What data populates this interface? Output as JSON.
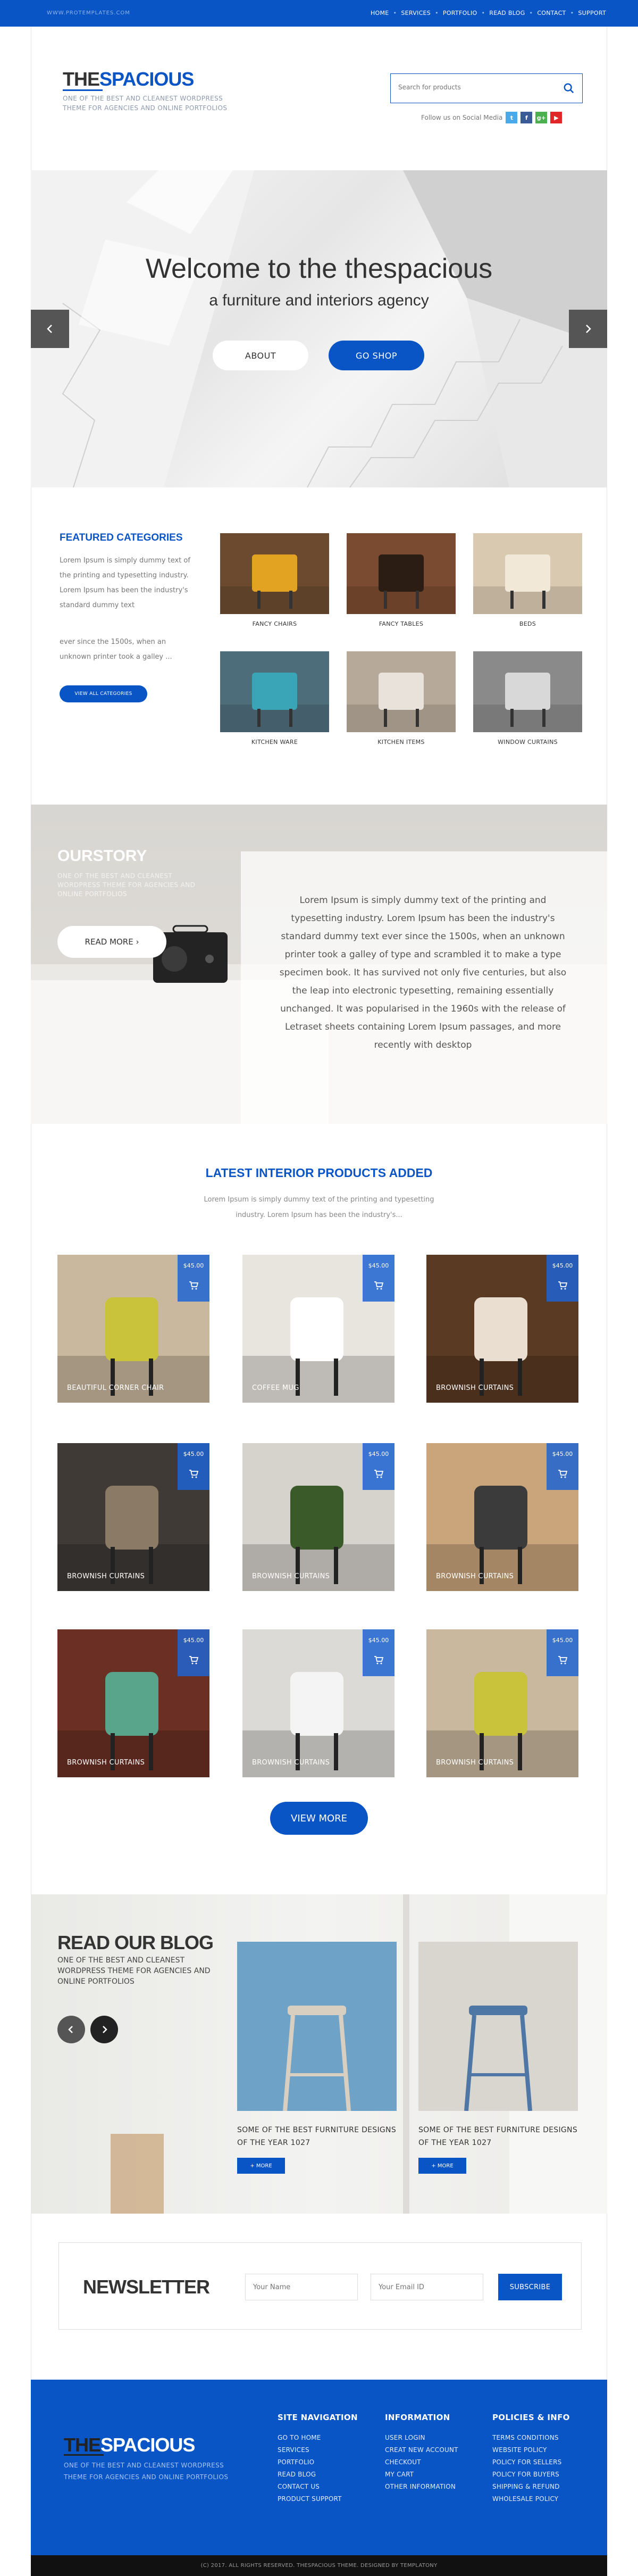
{
  "topbar": {
    "site": "WWW.PROTEMPLATES.COM",
    "nav": [
      "HOME",
      "SERVICES",
      "PORTFOLIO",
      "READ BLOG",
      "CONTACT",
      "SUPPORT"
    ]
  },
  "header": {
    "logo_a": "THE",
    "logo_b": "SPACIOUS",
    "tagline": "ONE OF THE BEST AND CLEANEST WORDPRESS THEME FOR AGENCIES AND ONLINE PORTFOLIOS",
    "search_placeholder": "Search for products",
    "social_label": "Follow us on Social Media",
    "social": [
      {
        "icon": "twitter-icon",
        "glyph": "t",
        "color": "#4aa9e8"
      },
      {
        "icon": "facebook-icon",
        "glyph": "f",
        "color": "#3b5b98"
      },
      {
        "icon": "google-plus-icon",
        "glyph": "g+",
        "color": "#4caf50"
      },
      {
        "icon": "youtube-icon",
        "glyph": "▶",
        "color": "#e02626"
      }
    ]
  },
  "hero": {
    "title": "Welcome to the thespacious",
    "subtitle": "a furniture and interiors agency",
    "about": "ABOUT",
    "shop": "GO SHOP"
  },
  "featured": {
    "title": "FEATURED CATEGORIES",
    "text": "Lorem Ipsum is simply dummy text of the printing and typesetting industry. Lorem Ipsum has been the industry's standard dummy text",
    "text2": "ever since the 1500s, when an unknown printer took a galley ...",
    "button": "VIEW ALL CATEGORIES",
    "categories": [
      {
        "label": "FANCY CHAIRS",
        "bg": "#6b4a2f",
        "accent": "#e3a322"
      },
      {
        "label": "FANCY TABLES",
        "bg": "#7a4b30",
        "accent": "#2c1d14"
      },
      {
        "label": "BEDS",
        "bg": "#d9c9b0",
        "accent": "#f1e8d8"
      },
      {
        "label": "KITCHEN WARE",
        "bg": "#4e6d7a",
        "accent": "#3aa5b6"
      },
      {
        "label": "KITCHEN ITEMS",
        "bg": "#b7a99a",
        "accent": "#e8e2da"
      },
      {
        "label": "WINDOW CURTAINS",
        "bg": "#8a8a8a",
        "accent": "#d8d8d8"
      }
    ]
  },
  "story": {
    "title": "OURSTORY",
    "subtitle": "ONE OF THE BEST AND CLEANEST WORDPRESS THEME FOR AGENCIES AND ONLINE PORTFOLIOS",
    "button": "READ MORE ›",
    "text": "Lorem Ipsum is simply dummy text of the printing and typesetting industry. Lorem Ipsum has been the industry's standard dummy text ever since the 1500s, when an unknown printer took a galley of type and scrambled it to make a type specimen book. It has survived not only five centuries, but also the leap into electronic typesetting, remaining essentially unchanged. It was popularised in the 1960s with the release of Letraset sheets containing Lorem Ipsum passages, and more recently with desktop"
  },
  "products": {
    "title": "LATEST INTERIOR PRODUCTS ADDED",
    "subtitle": "Lorem Ipsum is simply dummy text of the printing and typesetting industry. Lorem Ipsum has been the industry's...",
    "items": [
      {
        "name": "BEAUTIFUL CORNER CHAIR",
        "price": "$45.00",
        "bg": "#c9b89e",
        "accent": "#c8c33a"
      },
      {
        "name": "COFFEE MUG",
        "price": "$45.00",
        "bg": "#e8e4de",
        "accent": "#ffffff"
      },
      {
        "name": "BROWNISH CURTAINS",
        "price": "$45.00",
        "bg": "#5b3a24",
        "accent": "#e9ded0"
      },
      {
        "name": "BROWNISH CURTAINS",
        "price": "$45.00",
        "bg": "#3f3a36",
        "accent": "#8a7a66"
      },
      {
        "name": "BROWNISH CURTAINS",
        "price": "$45.00",
        "bg": "#d6d2cc",
        "accent": "#3a5a2a"
      },
      {
        "name": "BROWNISH CURTAINS",
        "price": "$45.00",
        "bg": "#caa47a",
        "accent": "#3b3b3b"
      },
      {
        "name": "BROWNISH CURTAINS",
        "price": "$45.00",
        "bg": "#6b2f23",
        "accent": "#58a58c"
      },
      {
        "name": "BROWNISH CURTAINS",
        "price": "$45.00",
        "bg": "#dcdad6",
        "accent": "#f4f4f4"
      },
      {
        "name": "BROWNISH CURTAINS",
        "price": "$45.00",
        "bg": "#c9b89e",
        "accent": "#c8c33a"
      }
    ],
    "view_more": "VIEW MORE"
  },
  "blog": {
    "title": "READ OUR BLOG",
    "subtitle": "ONE OF THE BEST AND CLEANEST WORDPRESS THEME FOR AGENCIES AND ONLINE PORTFOLIOS",
    "posts": [
      {
        "title": "SOME OF THE BEST FURNITURE DESIGNS OF THE YEAR 1027",
        "more": "+ MORE",
        "bg": "#6fa2c7",
        "accent": "#d9cfc0"
      },
      {
        "title": "SOME OF THE BEST FURNITURE DESIGNS OF THE YEAR 1027",
        "more": "+ MORE",
        "bg": "#d9d6cf",
        "accent": "#4f77a6"
      }
    ]
  },
  "newsletter": {
    "title": "NEWSLETTER",
    "name_placeholder": "Your Name",
    "email_placeholder": "Your Email ID",
    "button": "SUBSCRIBE"
  },
  "footer": {
    "logo_a": "THE",
    "logo_b": "SPACIOUS",
    "tagline": "ONE OF THE BEST AND CLEANEST WORDPRESS THEME FOR AGENCIES AND ONLINE PORTFOLIOS",
    "cols": [
      {
        "title": "SITE NAVIGATION",
        "items": [
          "GO TO HOME",
          "SERVICES",
          "PORTFOLIO",
          "READ BLOG",
          "CONTACT US",
          "PRODUCT SUPPORT"
        ]
      },
      {
        "title": "INFORMATION",
        "items": [
          "USER LOGIN",
          "CREAT NEW ACCOUNT",
          "CHECKOUT",
          "MY CART",
          "OTHER INFORMATION"
        ]
      },
      {
        "title": "POLICIES & INFO",
        "items": [
          "TERMS CONDITIONS",
          "WEBSITE POLICY",
          "POLICY FOR SELLERS",
          "POLICY FOR BUYERS",
          "SHIPPING & REFUND",
          "WHOLESALE POLICY"
        ]
      }
    ],
    "copyright": "(C) 2017. ALL RIGHTS RESERVED. THESPACIOUS THEME. DESIGNED BY TEMPLATONY"
  }
}
